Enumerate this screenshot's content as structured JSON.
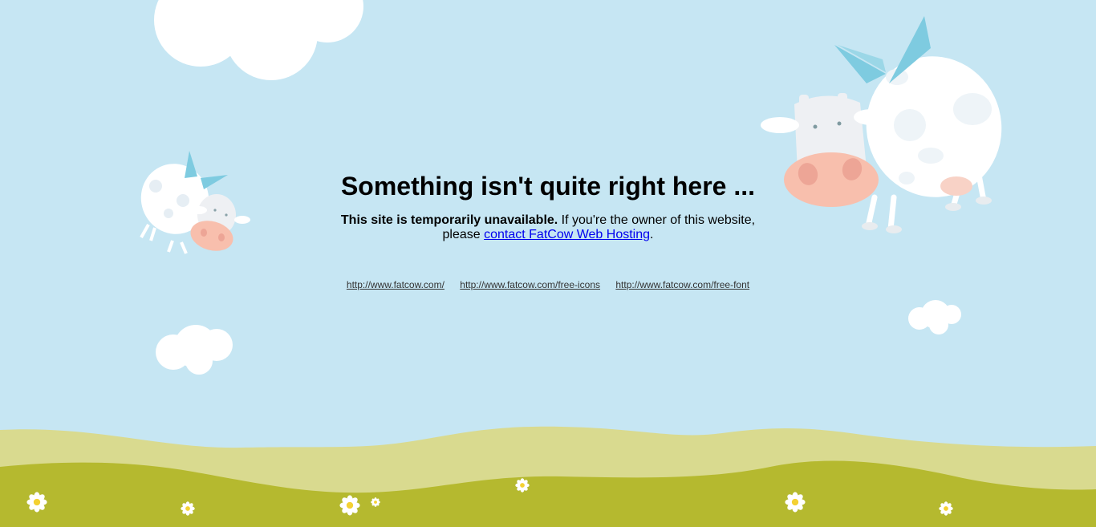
{
  "page": {
    "headline": "Something isn't quite right here ...",
    "message_bold": "This site is temporarily unavailable.",
    "message_text": " If you're the owner of this website, please ",
    "contact_link": "contact FatCow Web Hosting",
    "message_end": "."
  },
  "footer_links": [
    "http://www.fatcow.com/",
    "http://www.fatcow.com/free-icons",
    "http://www.fatcow.com/free-font"
  ],
  "colors": {
    "sky": "#c6e6f3",
    "hill_back": "#d9da8f",
    "hill_front": "#b5b92f",
    "cloud": "#ffffff",
    "cow_nose": "#f8bfad",
    "wing": "#7ecbe0"
  },
  "decorations": {
    "clouds": [
      "cloud-icon",
      "cloud-icon",
      "cloud-icon",
      "cloud-icon"
    ],
    "cows": [
      "flying-cow-icon",
      "flying-cow-icon"
    ],
    "flowers": "daisy-icon"
  }
}
